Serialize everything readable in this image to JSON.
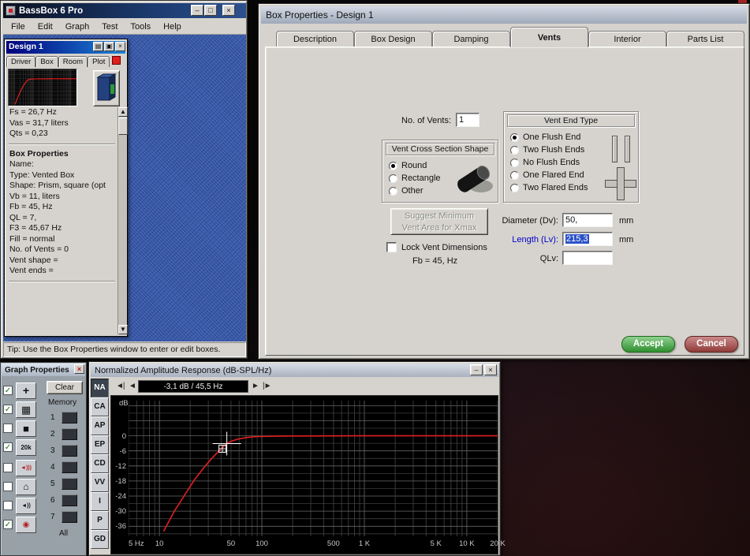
{
  "icons": {
    "minimize": "–",
    "maximize": "□",
    "close": "×",
    "save": "▤",
    "restore": "▣",
    "up": "▲",
    "down": "▼",
    "left_end": "◄|",
    "left": "◄",
    "right": "►",
    "right_end": "|►",
    "check": "✓"
  },
  "colors": {
    "accent_red": "#e02020",
    "accept_green": "#2f8f2f",
    "cancel_red": "#8f3c38",
    "selection_blue": "#2a52c8",
    "mdi_blue": "#3a5cae"
  },
  "main_window": {
    "title": "BassBox 6 Pro",
    "menu": [
      "File",
      "Edit",
      "Graph",
      "Test",
      "Tools",
      "Help"
    ],
    "design": {
      "title": "Design 1",
      "tabs": [
        "Driver",
        "Box",
        "Room",
        "Plot"
      ],
      "lines": [
        {
          "t": "Fs =  26,7 Hz"
        },
        {
          "t": "Vas =  31,7 liters"
        },
        {
          "t": "Qts = 0,23"
        },
        {
          "d": true
        },
        {
          "t": "Box Properties",
          "b": true
        },
        {
          "t": "Name:"
        },
        {
          "t": "Type: Vented Box"
        },
        {
          "t": "Shape: Prism, square (opt"
        },
        {
          "t": "Vb = 11, liters"
        },
        {
          "t": "Fb = 45, Hz"
        },
        {
          "t": "QL = 7,"
        },
        {
          "t": "F3 = 45,67 Hz"
        },
        {
          "t": "Fill = normal"
        },
        {
          "t": "No. of Vents = 0"
        },
        {
          "t": " Vent shape ="
        },
        {
          "t": " Vent ends ="
        },
        {
          "d": true
        }
      ]
    },
    "tip": "Tip: Use the Box Properties window to enter or edit boxes."
  },
  "box_dialog": {
    "title": "Box Properties - Design 1",
    "tabs": [
      "Description",
      "Box Design",
      "Damping",
      "Vents",
      "Interior",
      "Parts List"
    ],
    "active_tab": "Vents",
    "vents": {
      "no_of_vents_label": "No. of Vents:",
      "no_of_vents_value": "1",
      "end_type": {
        "title": "Vent End Type",
        "options": [
          "One Flush End",
          "Two Flush Ends",
          "No Flush Ends",
          "One Flared End",
          "Two Flared Ends"
        ],
        "selected": "One Flush End"
      },
      "cross_section": {
        "title": "Vent Cross Section Shape",
        "options": [
          "Round",
          "Rectangle",
          "Other"
        ],
        "selected": "Round"
      },
      "suggest_line1": "Suggest Minimum",
      "suggest_line2": "Vent Area for Xmax",
      "lock_label": "Lock Vent Dimensions",
      "fb_text": "Fb = 45, Hz",
      "fields": [
        {
          "label": "Diameter (Dv):",
          "value": "50,",
          "unit": "mm"
        },
        {
          "label": "Length (Lv):",
          "value": "215,3",
          "unit": "mm"
        },
        {
          "label": "QLv:",
          "value": "",
          "unit": ""
        }
      ]
    },
    "accept_label": "Accept",
    "cancel_label": "Cancel"
  },
  "graph_properties": {
    "title": "Graph Properties",
    "clear_label": "Clear",
    "memory_label": "Memory",
    "memory_slots": [
      "1",
      "2",
      "3",
      "4",
      "5",
      "6",
      "7"
    ],
    "all_label": "All",
    "toggles": [
      {
        "icon": "crosshair-icon",
        "checked": true
      },
      {
        "icon": "grid-icon",
        "checked": true
      },
      {
        "icon": "fill-icon",
        "checked": false
      },
      {
        "icon": "trace-20k-icon",
        "checked": true
      },
      {
        "icon": "speaker-loud-icon",
        "checked": false
      },
      {
        "icon": "room-icon",
        "checked": false
      },
      {
        "icon": "speaker-icon",
        "checked": false
      },
      {
        "icon": "mic-icon",
        "checked": true
      }
    ]
  },
  "amp_window": {
    "title": "Normalized Amplitude Response (dB-SPL/Hz)",
    "side_buttons": [
      "NA",
      "CA",
      "AP",
      "EP",
      "CD",
      "VV",
      "I",
      "P",
      "GD"
    ],
    "active_side_button": "NA",
    "readout": "-3,1 dB / 45,5 Hz"
  },
  "chart_data": {
    "type": "line",
    "title": "Normalized Amplitude Response (dB-SPL/Hz)",
    "ylabel": "dB",
    "x_scale": "log",
    "xlim": [
      5,
      20000
    ],
    "ylim": [
      -40,
      14
    ],
    "grid": true,
    "yticks": [
      0,
      -6,
      -12,
      -18,
      -24,
      -30,
      -36
    ],
    "xticks": [
      {
        "f": 5,
        "label": "5 Hz"
      },
      {
        "f": 10,
        "label": "10"
      },
      {
        "f": 50,
        "label": "50"
      },
      {
        "f": 100,
        "label": "100"
      },
      {
        "f": 500,
        "label": "500"
      },
      {
        "f": 1000,
        "label": "1 K"
      },
      {
        "f": 5000,
        "label": "5 K"
      },
      {
        "f": 10000,
        "label": "10 K"
      },
      {
        "f": 20000,
        "label": "20 K"
      }
    ],
    "series": [
      {
        "name": "vented-box-response",
        "color": "#e02020",
        "points": [
          [
            11,
            -38
          ],
          [
            14,
            -30
          ],
          [
            18,
            -23
          ],
          [
            22,
            -17.5
          ],
          [
            27,
            -12.8
          ],
          [
            32,
            -9.3
          ],
          [
            37,
            -6.6
          ],
          [
            42,
            -4.4
          ],
          [
            45.5,
            -3.1
          ],
          [
            50,
            -2.2
          ],
          [
            57,
            -1.4
          ],
          [
            70,
            -0.7
          ],
          [
            90,
            -0.3
          ],
          [
            150,
            -0.1
          ],
          [
            1000,
            0
          ],
          [
            20000,
            0
          ]
        ]
      }
    ],
    "cursor": {
      "freq": 45.5,
      "db": -3.1
    }
  }
}
